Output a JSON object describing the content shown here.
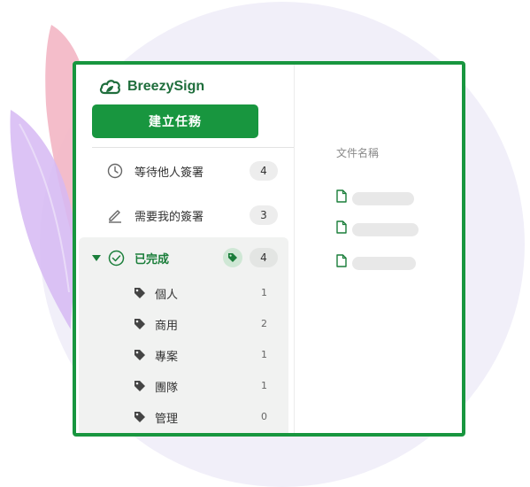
{
  "brand": {
    "name": "BreezySign",
    "color": "#18963f"
  },
  "sidebar": {
    "create_button": "建立任務",
    "items": [
      {
        "label": "等待他人簽署",
        "count": "4",
        "icon": "clock-icon"
      },
      {
        "label": "需要我的簽署",
        "count": "3",
        "icon": "pencil-icon"
      }
    ],
    "done": {
      "label": "已完成",
      "count": "4",
      "icon": "check-circle-icon",
      "tags": [
        {
          "label": "個人",
          "count": "1"
        },
        {
          "label": "商用",
          "count": "2"
        },
        {
          "label": "專案",
          "count": "1"
        },
        {
          "label": "團隊",
          "count": "1"
        },
        {
          "label": "管理",
          "count": "0"
        }
      ]
    }
  },
  "documents": {
    "header": "文件名稱",
    "rows": [
      {
        "icon": "document-icon"
      },
      {
        "icon": "document-icon"
      },
      {
        "icon": "document-icon"
      }
    ]
  },
  "colors": {
    "accent": "#18963f",
    "leaf_pink": "#f3b6c4",
    "leaf_purple": "#d6b8f3",
    "background_circle": "#f1eff9"
  }
}
